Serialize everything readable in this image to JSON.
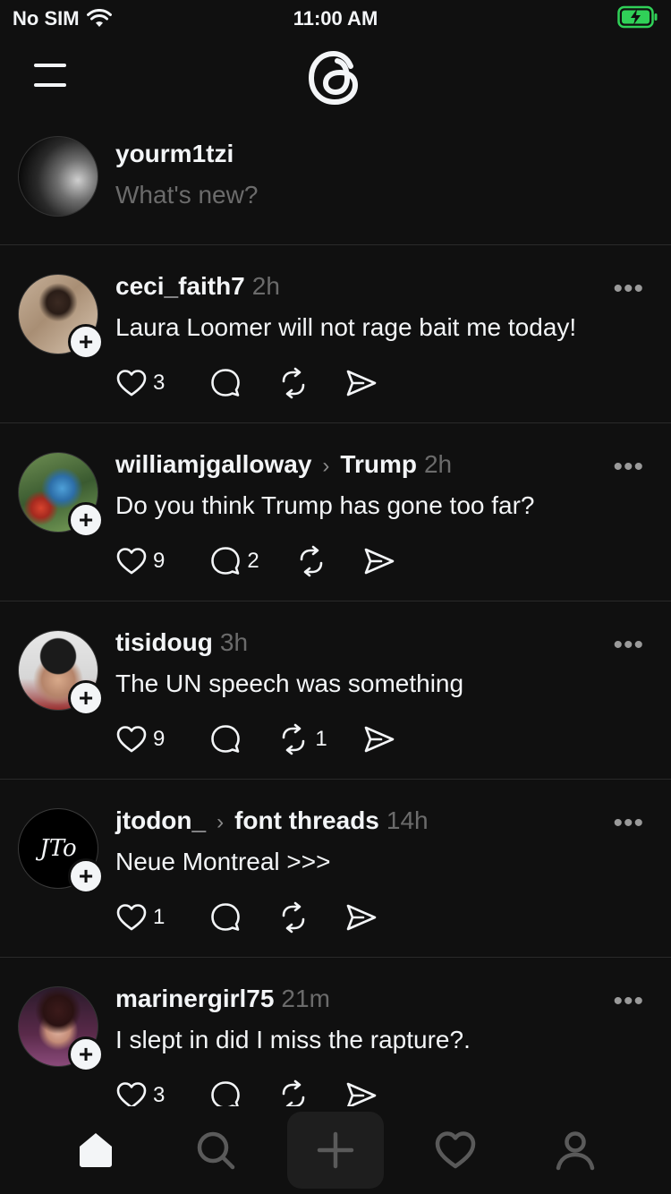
{
  "status_bar": {
    "carrier": "No SIM",
    "time": "11:00 AM",
    "wifi_icon": "wifi-icon",
    "battery_icon": "battery-charging-icon",
    "battery_color": "#30d158"
  },
  "header": {
    "menu_icon": "hamburger-menu-icon",
    "logo": "threads-logo-icon"
  },
  "composer": {
    "username": "yourm1tzi",
    "placeholder": "What's new?"
  },
  "posts": [
    {
      "author": "ceci_faith7",
      "topic": "",
      "time": "2h",
      "text": "Laura Loomer will not rage bait me today!",
      "likes": "3",
      "replies": "",
      "reposts": ""
    },
    {
      "author": "williamjgalloway",
      "topic": "Trump",
      "time": "2h",
      "text": "Do you think Trump has gone too far?",
      "likes": "9",
      "replies": "2",
      "reposts": ""
    },
    {
      "author": "tisidoug",
      "topic": "",
      "time": "3h",
      "text": "The UN speech was something",
      "likes": "9",
      "replies": "",
      "reposts": "1"
    },
    {
      "author": "jtodon_",
      "topic": "font threads",
      "time": "14h",
      "text": "Neue Montreal >>>",
      "likes": "1",
      "replies": "",
      "reposts": "",
      "avatar_text": "JTo"
    },
    {
      "author": "marinergirl75",
      "topic": "",
      "time": "21m",
      "text": "I slept in did I miss the rapture?.",
      "likes": "3",
      "replies": "",
      "reposts": ""
    }
  ],
  "tab_bar": {
    "items": [
      "home-icon",
      "search-icon",
      "compose-plus-icon",
      "activity-heart-icon",
      "profile-icon"
    ],
    "active": "home-icon"
  },
  "colors": {
    "background": "#101010",
    "text": "#f3f5f7",
    "muted": "#6b6b6b",
    "divider": "#2a2a2a"
  }
}
